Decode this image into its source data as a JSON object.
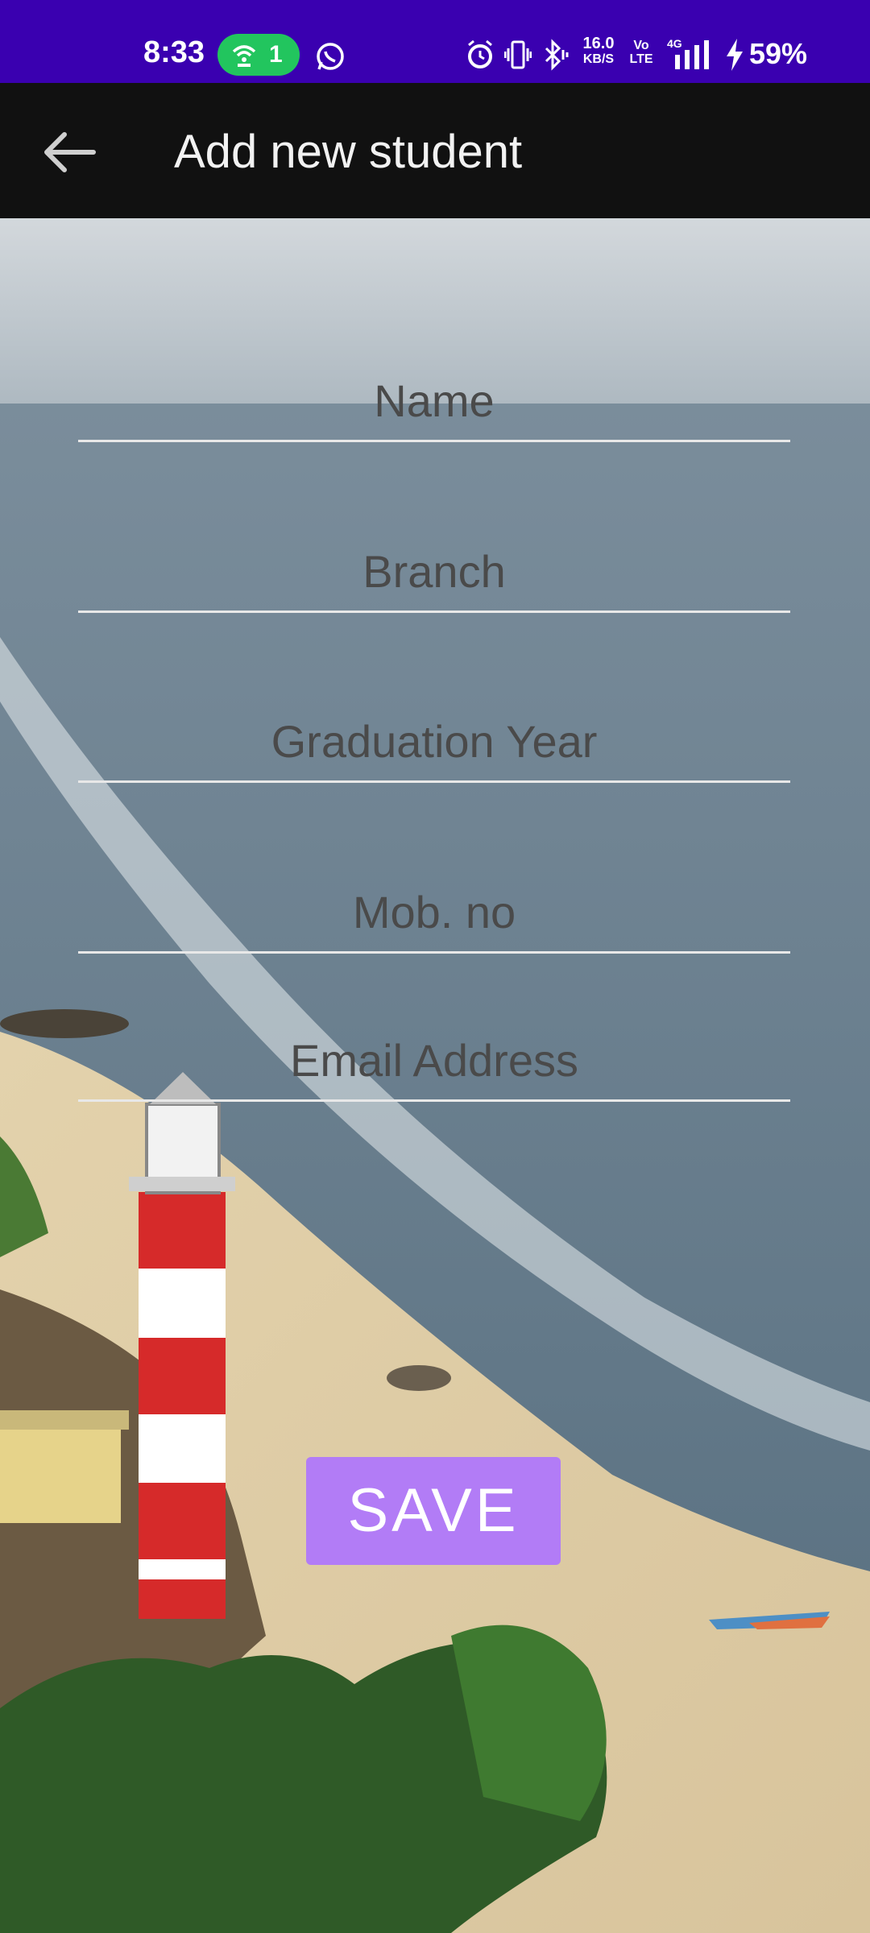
{
  "status_bar": {
    "time": "8:33",
    "hotspot_count": "1",
    "network_speed_value": "16.0",
    "network_speed_unit": "KB/S",
    "volte_top": "Vo",
    "volte_bottom": "LTE",
    "network_type": "4G",
    "battery_percent": "59%"
  },
  "app_bar": {
    "title": "Add new student",
    "back_icon": "arrow-left-icon"
  },
  "form": {
    "name_placeholder": "Name",
    "branch_placeholder": "Branch",
    "graduation_year_placeholder": "Graduation Year",
    "mobile_placeholder": "Mob. no",
    "email_placeholder": "Email Address",
    "save_label": "SAVE"
  },
  "colors": {
    "status_bar": "#3a00b0",
    "app_bar": "#111111",
    "save_button": "#b27cf6",
    "hotspot_pill": "#22c55e"
  }
}
